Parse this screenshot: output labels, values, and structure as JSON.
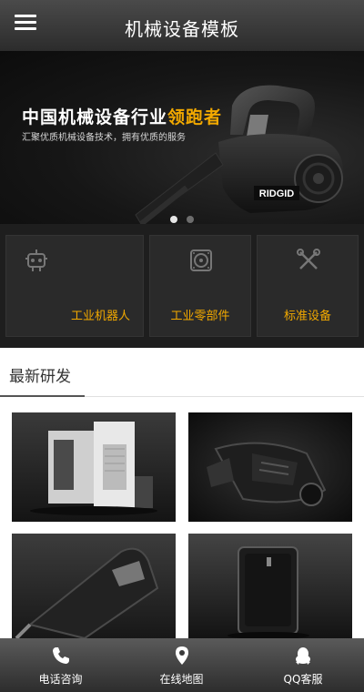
{
  "header": {
    "title": "机械设备模板",
    "menu_icon": "hamburger-menu-icon"
  },
  "banner": {
    "headline_main": "中国机械设备行业",
    "headline_highlight": "领跑者",
    "subtitle": "汇聚优质机械设备技术，拥有优质的服务",
    "brand_text": "RIDGID",
    "slide_count": 2,
    "active_slide": 1,
    "highlight_color": "#f2a900"
  },
  "categories": [
    {
      "label": "工业机器人",
      "icon": "robot-icon"
    },
    {
      "label": "工业零部件",
      "icon": "speaker-part-icon"
    },
    {
      "label": "标准设备",
      "icon": "tools-icon"
    }
  ],
  "section": {
    "title": "最新研发"
  },
  "footer": {
    "items": [
      {
        "label": "电话咨询",
        "icon": "phone-icon"
      },
      {
        "label": "在线地图",
        "icon": "map-pin-icon"
      },
      {
        "label": "QQ客服",
        "icon": "qq-penguin-icon"
      }
    ]
  }
}
